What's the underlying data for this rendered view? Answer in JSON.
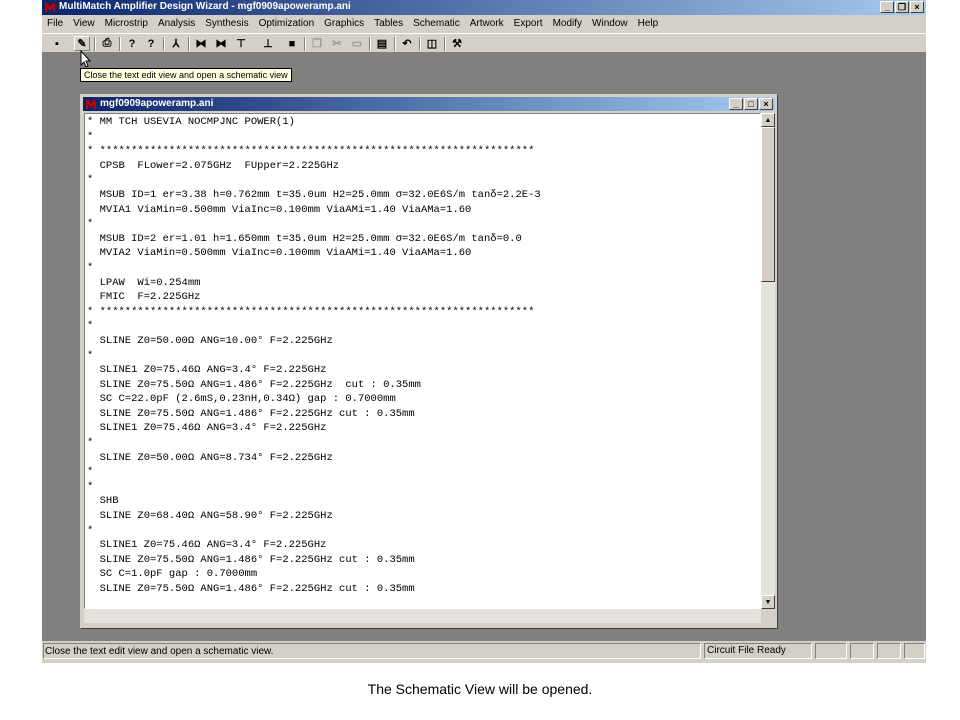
{
  "window": {
    "title": "MultiMatch Amplifier Design Wizard - mgf0909apoweramp.ani",
    "buttons": {
      "minimize": "_",
      "maximize": "❐",
      "close": "×"
    }
  },
  "menu": [
    "File",
    "View",
    "Microstrip",
    "Analysis",
    "Synthesis",
    "Optimization",
    "Graphics",
    "Tables",
    "Schematic",
    "Artwork",
    "Export",
    "Modify",
    "Window",
    "Help"
  ],
  "toolbar": {
    "buttons": [
      {
        "name": "save-icon",
        "glyph": "▪"
      },
      {
        "name": "open-schematic-icon",
        "glyph": "✎"
      },
      {
        "name": "print-icon",
        "glyph": "⎙"
      },
      {
        "name": "help-icon",
        "glyph": "?"
      },
      {
        "name": "context-help-icon",
        "glyph": "?"
      },
      {
        "name": "amplifier-icon",
        "glyph": "⅄"
      },
      {
        "name": "tool-1-icon",
        "glyph": "⧓"
      },
      {
        "name": "tool-2-icon",
        "glyph": "⧓"
      },
      {
        "name": "tool-3-icon",
        "glyph": "⊤"
      },
      {
        "name": "tool-4-icon",
        "glyph": "⊥"
      },
      {
        "name": "stop-icon",
        "glyph": "■"
      },
      {
        "name": "copy-icon",
        "glyph": "❐"
      },
      {
        "name": "cut-icon",
        "glyph": "✂"
      },
      {
        "name": "paste-icon",
        "glyph": "▭"
      },
      {
        "name": "clipboard-icon",
        "glyph": "▤"
      },
      {
        "name": "undo-icon",
        "glyph": "↶"
      },
      {
        "name": "window-icon",
        "glyph": "◫"
      },
      {
        "name": "hammer-icon",
        "glyph": "⚒"
      }
    ]
  },
  "tooltip": "Close the text edit view and open a schematic view",
  "child_window": {
    "title": "mgf0909apoweramp.ani",
    "buttons": {
      "minimize": "_",
      "maximize": "□",
      "close": "×"
    },
    "lines": [
      "* MM TCH USEVIA NOCMPJNC POWER(1)",
      "*",
      "* *********************************************************************",
      "  CPSB  FLower=2.075GHz  FUpper=2.225GHz",
      "*",
      "  MSUB ID=1 er=3.38 h=0.762mm t=35.0um H2=25.0mm σ=32.0E6S/m tanδ=2.2E-3",
      "  MVIA1 ViaMin=0.500mm ViaInc=0.100mm ViaAMi=1.40 ViaAMa=1.60",
      "*",
      "  MSUB ID=2 er=1.01 h=1.650mm t=35.0um H2=25.0mm σ=32.0E6S/m tanδ=0.0",
      "  MVIA2 ViaMin=0.500mm ViaInc=0.100mm ViaAMi=1.40 ViaAMa=1.60",
      "*",
      "  LPAW  Wi=0.254mm",
      "  FMIC  F=2.225GHz",
      "* *********************************************************************",
      "*",
      "  SLINE Z0=50.00Ω ANG=10.00° F=2.225GHz",
      "*",
      "  SLINE1 Z0=75.46Ω ANG=3.4° F=2.225GHz",
      "  SLINE Z0=75.50Ω ANG=1.486° F=2.225GHz  cut : 0.35mm",
      "  SC C=22.0pF (2.6mS,0.23nH,0.34Ω) gap : 0.7000mm",
      "  SLINE Z0=75.50Ω ANG=1.486° F=2.225GHz cut : 0.35mm",
      "  SLINE1 Z0=75.46Ω ANG=3.4° F=2.225GHz",
      "*",
      "  SLINE Z0=50.00Ω ANG=8.734° F=2.225GHz",
      "*",
      "*",
      "  SHB",
      "  SLINE Z0=68.40Ω ANG=58.90° F=2.225GHz",
      "*",
      "  SLINE1 Z0=75.46Ω ANG=3.4° F=2.225GHz",
      "  SLINE Z0=75.50Ω ANG=1.486° F=2.225GHz cut : 0.35mm",
      "  SC C=1.0pF gap : 0.7000mm",
      "  SLINE Z0=75.50Ω ANG=1.486° F=2.225GHz cut : 0.35mm"
    ]
  },
  "scroll": {
    "up": "▲",
    "down": "▼"
  },
  "status": {
    "message": "Close the text edit view and open a schematic view.",
    "ready": "Circuit File Ready"
  },
  "caption": "The Schematic View will be opened.",
  "colors": {
    "titlebar_start": "#0a246a",
    "titlebar_end": "#a6caf0",
    "chrome": "#d4d0c8",
    "mdi_background": "#808080",
    "app_icon": "#c00000"
  }
}
